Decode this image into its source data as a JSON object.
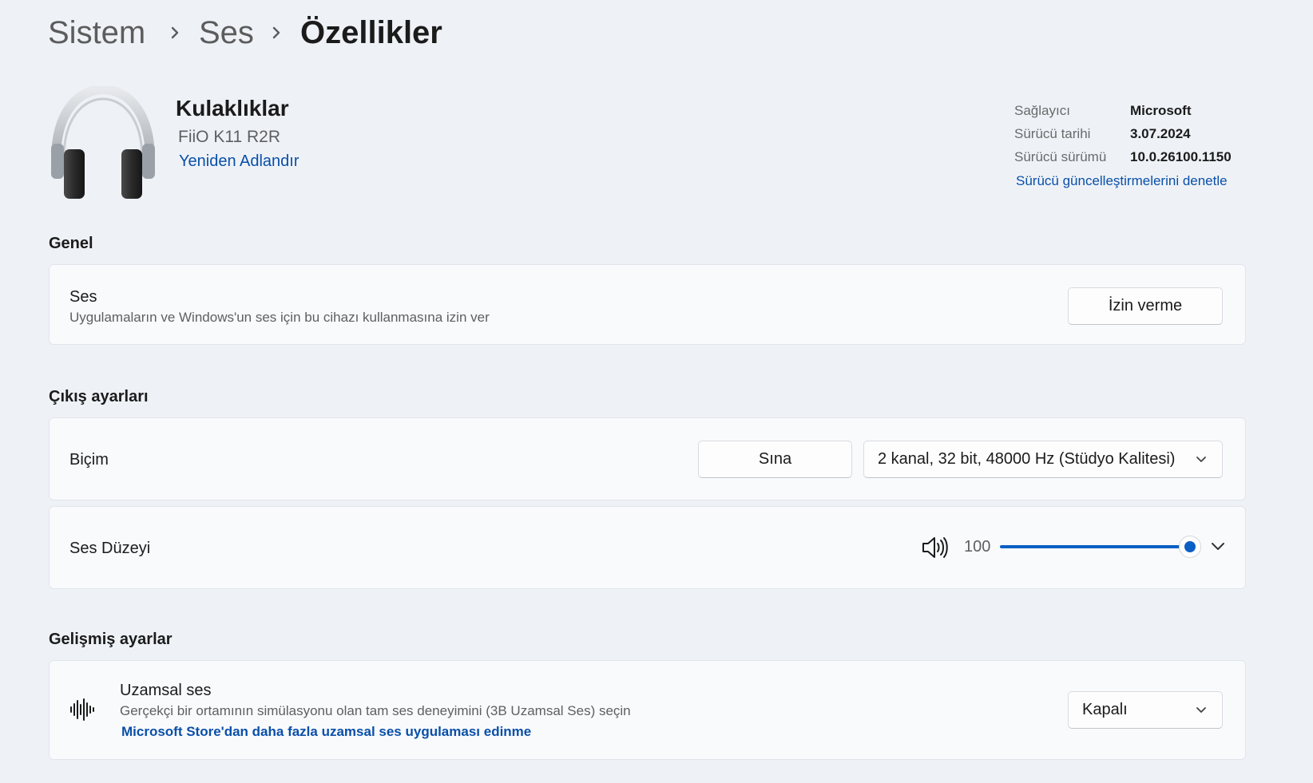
{
  "breadcrumb": {
    "items": [
      "Sistem",
      "Ses",
      "Özellikler"
    ]
  },
  "device": {
    "name": "Kulaklıklar",
    "model": "FiiO K11 R2R",
    "rename_link": "Yeniden Adlandır",
    "icon": "headphones-icon"
  },
  "driver": {
    "provider_label": "Sağlayıcı",
    "provider_value": "Microsoft",
    "date_label": "Sürücü tarihi",
    "date_value": "3.07.2024",
    "version_label": "Sürücü sürümü",
    "version_value": "10.0.26100.1150",
    "update_link": "Sürücü güncelleştirmelerini denetle"
  },
  "general": {
    "title": "Genel",
    "audio": {
      "title": "Ses",
      "description": "Uygulamaların ve Windows'un ses için bu cihazı kullanmasına izin ver",
      "button": "İzin verme"
    }
  },
  "output": {
    "title": "Çıkış ayarları",
    "format": {
      "label": "Biçim",
      "test_button": "Sına",
      "selected": "2 kanal, 32 bit, 48000 Hz (Stüdyo Kalitesi)"
    },
    "volume": {
      "label": "Ses Düzeyi",
      "value": "100",
      "level": 1.0,
      "icon": "speaker-icon"
    }
  },
  "advanced": {
    "title": "Gelişmiş ayarlar",
    "spatial": {
      "title": "Uzamsal ses",
      "description": "Gerçekçi bir ortamının simülasyonu olan tam ses deneyimini (3B Uzamsal Ses) seçin",
      "link": "Microsoft Store'dan daha fazla uzamsal ses uygulaması edinme",
      "selected": "Kapalı",
      "icon": "spatial-audio-icon"
    }
  },
  "colors": {
    "accent": "#0a5fc4",
    "link": "#0a4fa8",
    "background": "#eef2f7"
  }
}
